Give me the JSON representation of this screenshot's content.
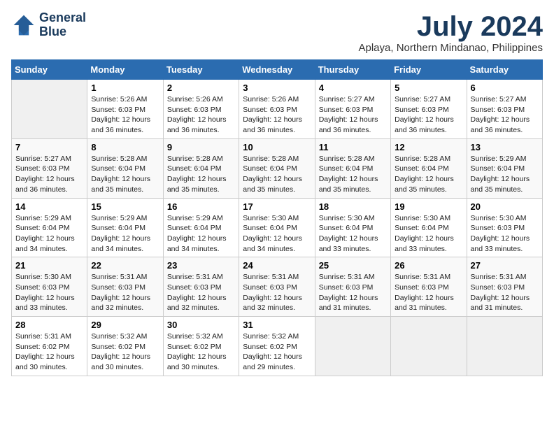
{
  "header": {
    "logo_line1": "General",
    "logo_line2": "Blue",
    "month_title": "July 2024",
    "location": "Aplaya, Northern Mindanao, Philippines"
  },
  "calendar": {
    "days_of_week": [
      "Sunday",
      "Monday",
      "Tuesday",
      "Wednesday",
      "Thursday",
      "Friday",
      "Saturday"
    ],
    "weeks": [
      [
        {
          "day": "",
          "info": ""
        },
        {
          "day": "1",
          "info": "Sunrise: 5:26 AM\nSunset: 6:03 PM\nDaylight: 12 hours\nand 36 minutes."
        },
        {
          "day": "2",
          "info": "Sunrise: 5:26 AM\nSunset: 6:03 PM\nDaylight: 12 hours\nand 36 minutes."
        },
        {
          "day": "3",
          "info": "Sunrise: 5:26 AM\nSunset: 6:03 PM\nDaylight: 12 hours\nand 36 minutes."
        },
        {
          "day": "4",
          "info": "Sunrise: 5:27 AM\nSunset: 6:03 PM\nDaylight: 12 hours\nand 36 minutes."
        },
        {
          "day": "5",
          "info": "Sunrise: 5:27 AM\nSunset: 6:03 PM\nDaylight: 12 hours\nand 36 minutes."
        },
        {
          "day": "6",
          "info": "Sunrise: 5:27 AM\nSunset: 6:03 PM\nDaylight: 12 hours\nand 36 minutes."
        }
      ],
      [
        {
          "day": "7",
          "info": "Sunrise: 5:27 AM\nSunset: 6:03 PM\nDaylight: 12 hours\nand 36 minutes."
        },
        {
          "day": "8",
          "info": "Sunrise: 5:28 AM\nSunset: 6:04 PM\nDaylight: 12 hours\nand 35 minutes."
        },
        {
          "day": "9",
          "info": "Sunrise: 5:28 AM\nSunset: 6:04 PM\nDaylight: 12 hours\nand 35 minutes."
        },
        {
          "day": "10",
          "info": "Sunrise: 5:28 AM\nSunset: 6:04 PM\nDaylight: 12 hours\nand 35 minutes."
        },
        {
          "day": "11",
          "info": "Sunrise: 5:28 AM\nSunset: 6:04 PM\nDaylight: 12 hours\nand 35 minutes."
        },
        {
          "day": "12",
          "info": "Sunrise: 5:28 AM\nSunset: 6:04 PM\nDaylight: 12 hours\nand 35 minutes."
        },
        {
          "day": "13",
          "info": "Sunrise: 5:29 AM\nSunset: 6:04 PM\nDaylight: 12 hours\nand 35 minutes."
        }
      ],
      [
        {
          "day": "14",
          "info": "Sunrise: 5:29 AM\nSunset: 6:04 PM\nDaylight: 12 hours\nand 34 minutes."
        },
        {
          "day": "15",
          "info": "Sunrise: 5:29 AM\nSunset: 6:04 PM\nDaylight: 12 hours\nand 34 minutes."
        },
        {
          "day": "16",
          "info": "Sunrise: 5:29 AM\nSunset: 6:04 PM\nDaylight: 12 hours\nand 34 minutes."
        },
        {
          "day": "17",
          "info": "Sunrise: 5:30 AM\nSunset: 6:04 PM\nDaylight: 12 hours\nand 34 minutes."
        },
        {
          "day": "18",
          "info": "Sunrise: 5:30 AM\nSunset: 6:04 PM\nDaylight: 12 hours\nand 33 minutes."
        },
        {
          "day": "19",
          "info": "Sunrise: 5:30 AM\nSunset: 6:04 PM\nDaylight: 12 hours\nand 33 minutes."
        },
        {
          "day": "20",
          "info": "Sunrise: 5:30 AM\nSunset: 6:03 PM\nDaylight: 12 hours\nand 33 minutes."
        }
      ],
      [
        {
          "day": "21",
          "info": "Sunrise: 5:30 AM\nSunset: 6:03 PM\nDaylight: 12 hours\nand 33 minutes."
        },
        {
          "day": "22",
          "info": "Sunrise: 5:31 AM\nSunset: 6:03 PM\nDaylight: 12 hours\nand 32 minutes."
        },
        {
          "day": "23",
          "info": "Sunrise: 5:31 AM\nSunset: 6:03 PM\nDaylight: 12 hours\nand 32 minutes."
        },
        {
          "day": "24",
          "info": "Sunrise: 5:31 AM\nSunset: 6:03 PM\nDaylight: 12 hours\nand 32 minutes."
        },
        {
          "day": "25",
          "info": "Sunrise: 5:31 AM\nSunset: 6:03 PM\nDaylight: 12 hours\nand 31 minutes."
        },
        {
          "day": "26",
          "info": "Sunrise: 5:31 AM\nSunset: 6:03 PM\nDaylight: 12 hours\nand 31 minutes."
        },
        {
          "day": "27",
          "info": "Sunrise: 5:31 AM\nSunset: 6:03 PM\nDaylight: 12 hours\nand 31 minutes."
        }
      ],
      [
        {
          "day": "28",
          "info": "Sunrise: 5:31 AM\nSunset: 6:02 PM\nDaylight: 12 hours\nand 30 minutes."
        },
        {
          "day": "29",
          "info": "Sunrise: 5:32 AM\nSunset: 6:02 PM\nDaylight: 12 hours\nand 30 minutes."
        },
        {
          "day": "30",
          "info": "Sunrise: 5:32 AM\nSunset: 6:02 PM\nDaylight: 12 hours\nand 30 minutes."
        },
        {
          "day": "31",
          "info": "Sunrise: 5:32 AM\nSunset: 6:02 PM\nDaylight: 12 hours\nand 29 minutes."
        },
        {
          "day": "",
          "info": ""
        },
        {
          "day": "",
          "info": ""
        },
        {
          "day": "",
          "info": ""
        }
      ]
    ]
  }
}
